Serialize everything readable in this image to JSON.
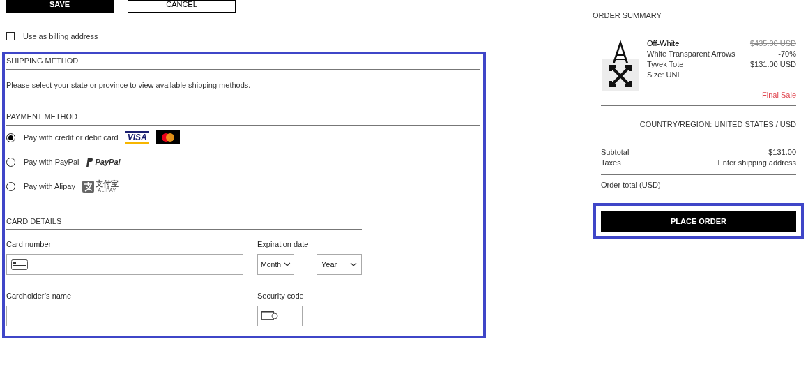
{
  "top_buttons": [
    {
      "label": "SAVE",
      "kind": "primary"
    },
    {
      "label": "CANCEL",
      "kind": "secondary"
    }
  ],
  "billing_checkbox": {
    "label": "Use as billing address",
    "checked": false
  },
  "shipping": {
    "title": "SHIPPING METHOD",
    "message": "Please select your state or province to view available shipping methods."
  },
  "payment": {
    "title": "PAYMENT METHOD",
    "options": [
      {
        "label": "Pay with credit or debit card",
        "selected": true,
        "kind": "card",
        "logo_text": [
          "VISA"
        ]
      },
      {
        "label": "Pay with PayPal",
        "selected": false,
        "kind": "paypal",
        "logo_text": [
          "PayPal"
        ]
      },
      {
        "label": "Pay with Alipay",
        "selected": false,
        "kind": "alipay",
        "logo_text": [
          "支付宝",
          "ALIPAY"
        ]
      }
    ]
  },
  "card_details": {
    "title": "CARD DETAILS",
    "fields": [
      {
        "label": "Card number",
        "kind": "card"
      },
      {
        "label": "Expiration date",
        "kind": "selects",
        "options": [
          "Month",
          "Year"
        ]
      },
      {
        "label": "Cardholder’s name",
        "kind": "text"
      },
      {
        "label": "Security code",
        "kind": "cvv"
      }
    ]
  },
  "summary": {
    "title": "ORDER SUMMARY",
    "item": {
      "brand": "Off-White",
      "name_lines": [
        "White Transparent Arrows",
        "Tyvek Tote"
      ],
      "size": "Size: UNI",
      "original_price": "$435.00 USD",
      "discount": "-70%",
      "price": "$131.00 USD",
      "note": "Final Sale"
    },
    "region": "COUNTRY/REGION: UNITED STATES / USD",
    "rows": [
      {
        "label": "Subtotal",
        "value": "$131.00"
      },
      {
        "label": "Taxes",
        "value": "Enter shipping address"
      }
    ],
    "total": {
      "label": "Order total (USD)",
      "value": "—"
    },
    "place_order": "PLACE ORDER"
  }
}
